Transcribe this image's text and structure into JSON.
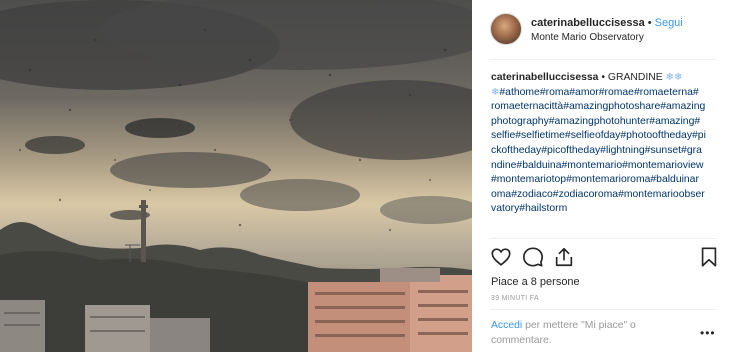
{
  "post": {
    "username": "caterinabelluccisessa",
    "follow_label": "Segui",
    "location": "Monte Mario Observatory",
    "caption_title": "GRANDINE",
    "caption_lines": [
      "#athome#roma#amor#romae#romaeterna#",
      "romaeternacittà#amazingphotoshare#amazing",
      "photography#amazingphotohunter#amazing#",
      "selfie#selfietime#selfieofday#photooftheday#pi",
      "ckoftheday#picoftheday#lightning#sunset#gra",
      "ndine#balduina#montemario#montemarioview",
      "#montemariotop#montemarioroma#balduinar",
      "oma#zodiaco#zodiacoroma#montemarioobser",
      "vatory#hailstorm"
    ],
    "likes_label": "Piace a 8 persone",
    "time_label": "39 MINUTI FA",
    "login_link": "Accedi",
    "login_rest": "per mettere \"Mi piace\" o commentare.",
    "more_label": "•••"
  },
  "icons": {
    "like": "heart-icon",
    "comment": "comment-icon",
    "share": "share-icon",
    "save": "bookmark-icon",
    "snow": "snowflake-icon"
  },
  "colors": {
    "link_blue": "#3897f0",
    "hashtag": "#003569",
    "muted": "#999999"
  }
}
